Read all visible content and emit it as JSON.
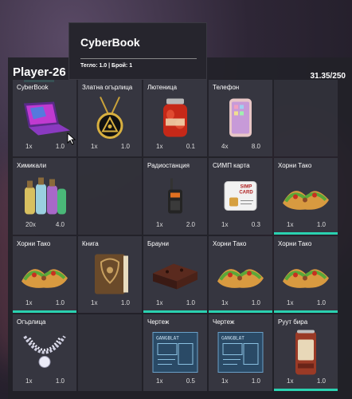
{
  "player_name": "Player-26",
  "weight": "31.35/250",
  "tooltip": {
    "title": "CyberBook",
    "info": "Тегло: 1.0 | Брой: 1"
  },
  "items": [
    {
      "name": "CyberBook",
      "count": "1x",
      "weight": "1.0",
      "icon": "laptop-icon",
      "bar": false
    },
    {
      "name": "Златна огърлица",
      "count": "1x",
      "weight": "1.0",
      "icon": "gold-necklace-icon",
      "bar": false
    },
    {
      "name": "Лютеница",
      "count": "1x",
      "weight": "0.1",
      "icon": "jar-icon",
      "bar": false
    },
    {
      "name": "Телефон",
      "count": "4x",
      "weight": "8.0",
      "icon": "phone-icon",
      "bar": false
    },
    {
      "name": "",
      "count": "",
      "weight": "",
      "icon": "",
      "bar": false
    },
    {
      "name": "Химикали",
      "count": "20x",
      "weight": "4.0",
      "icon": "chemicals-icon",
      "bar": false
    },
    {
      "name": "",
      "count": "",
      "weight": "",
      "icon": "",
      "bar": false
    },
    {
      "name": "Радиостанция",
      "count": "1x",
      "weight": "2.0",
      "icon": "radio-icon",
      "bar": false
    },
    {
      "name": "СИМП карта",
      "count": "1x",
      "weight": "0.3",
      "icon": "sim-card-icon",
      "sim_label": "SIMP CARD",
      "bar": false
    },
    {
      "name": "Хорни Тако",
      "count": "1x",
      "weight": "1.0",
      "icon": "taco-icon",
      "bar": true
    },
    {
      "name": "Хорни Тако",
      "count": "1x",
      "weight": "1.0",
      "icon": "taco-icon",
      "bar": true
    },
    {
      "name": "Книга",
      "count": "1x",
      "weight": "1.0",
      "icon": "book-icon",
      "bar": false
    },
    {
      "name": "Брауни",
      "count": "1x",
      "weight": "1.0",
      "icon": "brownie-icon",
      "bar": true
    },
    {
      "name": "Хорни Тако",
      "count": "1x",
      "weight": "1.0",
      "icon": "taco-icon",
      "bar": true
    },
    {
      "name": "Хорни Тако",
      "count": "1x",
      "weight": "1.0",
      "icon": "taco-icon",
      "bar": true
    },
    {
      "name": "Огърлица",
      "count": "1x",
      "weight": "1.0",
      "icon": "necklace-icon",
      "bar": false
    },
    {
      "name": "",
      "count": "",
      "weight": "",
      "icon": "",
      "bar": false
    },
    {
      "name": "Чертеж",
      "count": "1x",
      "weight": "0.5",
      "icon": "blueprint-icon",
      "bar": false
    },
    {
      "name": "Чертеж",
      "count": "1x",
      "weight": "1.0",
      "icon": "blueprint-icon",
      "bar": false
    },
    {
      "name": "Руут бира",
      "count": "1x",
      "weight": "1.0",
      "icon": "beer-can-icon",
      "bar": true
    }
  ]
}
